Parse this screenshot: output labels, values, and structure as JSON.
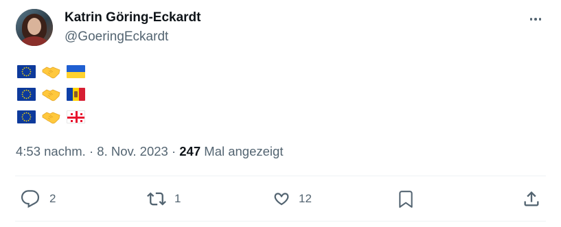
{
  "author": {
    "name": "Katrin Göring-Eckardt",
    "handle": "@GoeringEckardt"
  },
  "tweet": {
    "rows": [
      {
        "flag_left": "eu-flag",
        "symbol": "handshake",
        "flag_right": "ukraine-flag"
      },
      {
        "flag_left": "eu-flag",
        "symbol": "handshake",
        "flag_right": "moldova-flag"
      },
      {
        "flag_left": "eu-flag",
        "symbol": "handshake",
        "flag_right": "georgia-flag"
      }
    ]
  },
  "meta": {
    "time": "4:53 nachm.",
    "separator": " · ",
    "date": "8. Nov. 2023",
    "views_count": "247",
    "views_label": " Mal angezeigt"
  },
  "actions": {
    "replies": "2",
    "reposts": "1",
    "likes": "12"
  },
  "colors": {
    "text_primary": "#0f1419",
    "text_secondary": "#536471",
    "divider": "#eff3f4",
    "handshake": "#ffc83d"
  }
}
